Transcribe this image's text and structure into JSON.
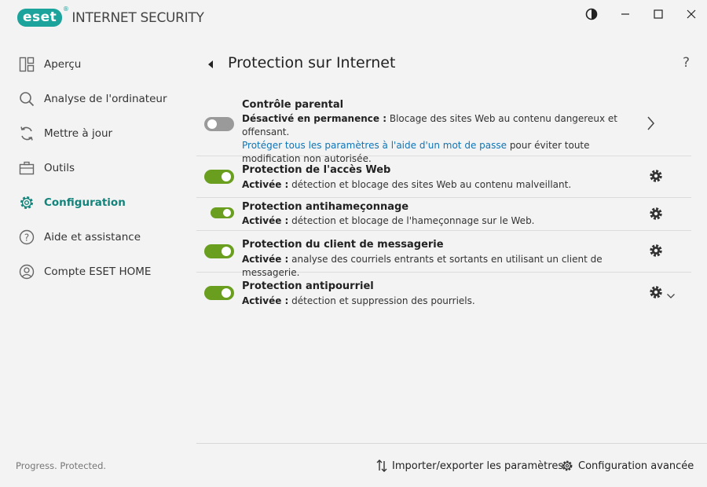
{
  "app": {
    "logo_text": "eset",
    "logo_reg": "®",
    "product_name": "INTERNET SECURITY",
    "tagline": "Progress. Protected."
  },
  "window_controls": {
    "theme": "contrast-icon",
    "minimize": "minimize-icon",
    "maximize": "maximize-icon",
    "close": "close-icon"
  },
  "sidebar": {
    "items": [
      {
        "label": "Aperçu",
        "icon": "overview-icon"
      },
      {
        "label": "Analyse de l'ordinateur",
        "icon": "search-icon"
      },
      {
        "label": "Mettre à jour",
        "icon": "refresh-icon"
      },
      {
        "label": "Outils",
        "icon": "toolbox-icon"
      },
      {
        "label": "Configuration",
        "icon": "gear-icon",
        "active": true
      },
      {
        "label": "Aide et assistance",
        "icon": "help-icon"
      },
      {
        "label": "Compte ESET HOME",
        "icon": "account-icon"
      }
    ]
  },
  "main": {
    "title": "Protection sur Internet",
    "help": "?",
    "rows": [
      {
        "title": "Contrôle parental",
        "status": "Désactivé en permanence :",
        "description": " Blocage des sites Web au contenu dangereux et offensant.",
        "link": "Protéger tous les paramètres à l'aide d'un mot de passe",
        "link_suffix": " pour éviter toute modification non autorisée.",
        "enabled": false
      },
      {
        "title": "Protection de l'accès Web",
        "status": "Activée :",
        "description": " détection et blocage des sites Web au contenu malveillant.",
        "enabled": true
      },
      {
        "title": "Protection antihameçonnage",
        "status": "Activée :",
        "description": " détection et blocage de l'hameçonnage sur le Web.",
        "enabled": true
      },
      {
        "title": "Protection du client de messagerie",
        "status": "Activée :",
        "description": " analyse des courriels entrants et sortants en utilisant un client de messagerie.",
        "enabled": true
      },
      {
        "title": "Protection antipourriel",
        "status": "Activée :",
        "description": " détection et suppression des pourriels.",
        "enabled": true
      }
    ],
    "bottom": {
      "import_export": "Importer/exporter les paramètres",
      "advanced": "Configuration avancée"
    }
  },
  "colors": {
    "brand": "#1ba39c",
    "active_nav": "#12847b",
    "toggle_on": "#6a9e1f",
    "toggle_off": "#9a9a9a",
    "link": "#0f75b7"
  }
}
